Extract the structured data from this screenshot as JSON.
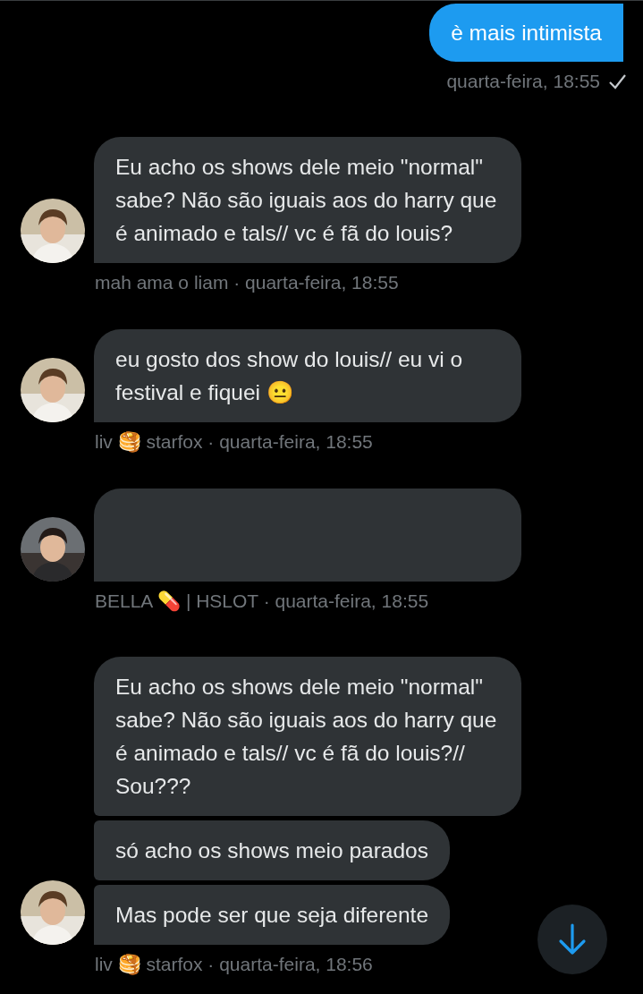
{
  "messages": [
    {
      "kind": "sent",
      "bubbles": [
        {
          "kind": "text",
          "text": "è mais intimista"
        }
      ],
      "meta": "quarta-feira, 18:55",
      "seen": true
    },
    {
      "kind": "received",
      "bubbles": [
        {
          "kind": "text",
          "text": "Eu acho os shows dele meio \"normal\" sabe? Não são iguais aos do harry que é animado e tals// vc é fã do louis?"
        }
      ],
      "meta": "mah ama o liam · quarta-feira, 18:55"
    },
    {
      "kind": "received",
      "bubbles": [
        {
          "kind": "text",
          "text": "eu gosto dos show do louis// eu vi o festival e fiquei 😐"
        }
      ],
      "meta": "liv 🥞 starfox · quarta-feira, 18:55"
    },
    {
      "kind": "received",
      "bubbles": [
        {
          "kind": "blank"
        }
      ],
      "meta": "BELLA 💊 | HSLOT · quarta-feira, 18:55"
    },
    {
      "kind": "received",
      "bubbles": [
        {
          "kind": "text",
          "text": "Eu acho os shows dele meio \"normal\" sabe? Não são iguais aos do harry que é animado e tals// vc é fã do louis?// Sou???"
        },
        {
          "kind": "text",
          "text": "só acho os shows meio parados"
        },
        {
          "kind": "text",
          "text": "Mas pode ser que seja diferente"
        }
      ],
      "meta": "liv 🥞 starfox · quarta-feira, 18:56"
    }
  ]
}
